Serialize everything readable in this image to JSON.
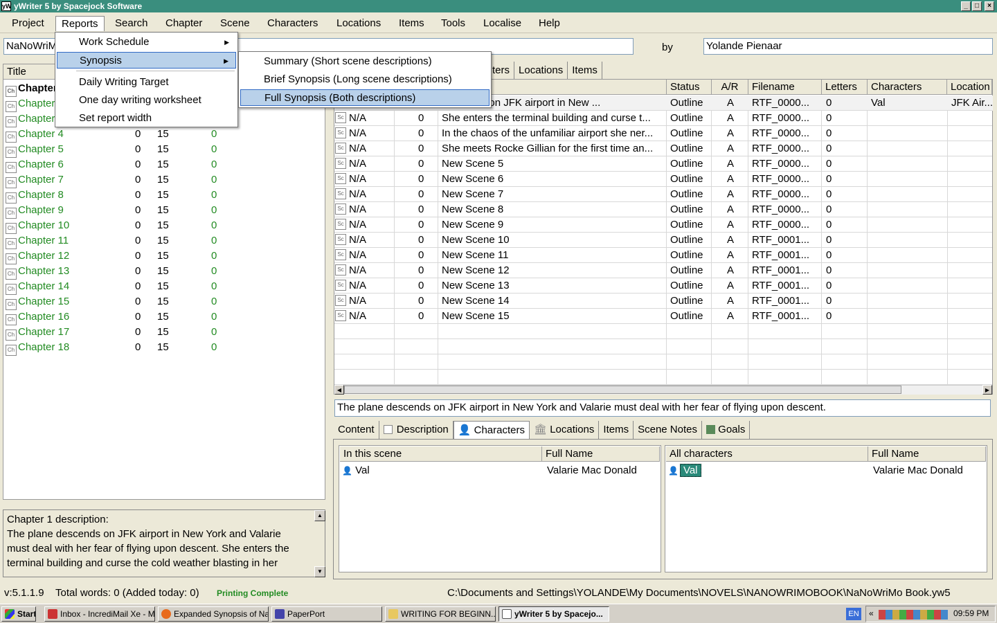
{
  "window": {
    "title": "yWriter 5 by Spacejock Software",
    "app_icon": "yW"
  },
  "menubar": [
    "Project",
    "Reports",
    "Search",
    "Chapter",
    "Scene",
    "Characters",
    "Locations",
    "Items",
    "Tools",
    "Localise",
    "Help"
  ],
  "project": {
    "title_value": "NaNoWriMo",
    "by_label": "by",
    "author_value": "Yolande Pienaar"
  },
  "chapters_panel": {
    "header_title": "Title",
    "first_rows": [
      "Chapter 1",
      "Chapter 2",
      "Chapter 3"
    ],
    "rows": [
      {
        "title": "Chapter 4",
        "a": "0",
        "b": "15",
        "c": "0"
      },
      {
        "title": "Chapter 5",
        "a": "0",
        "b": "15",
        "c": "0"
      },
      {
        "title": "Chapter 6",
        "a": "0",
        "b": "15",
        "c": "0"
      },
      {
        "title": "Chapter 7",
        "a": "0",
        "b": "15",
        "c": "0"
      },
      {
        "title": "Chapter 8",
        "a": "0",
        "b": "15",
        "c": "0"
      },
      {
        "title": "Chapter 9",
        "a": "0",
        "b": "15",
        "c": "0"
      },
      {
        "title": "Chapter 10",
        "a": "0",
        "b": "15",
        "c": "0"
      },
      {
        "title": "Chapter 11",
        "a": "0",
        "b": "15",
        "c": "0"
      },
      {
        "title": "Chapter 12",
        "a": "0",
        "b": "15",
        "c": "0"
      },
      {
        "title": "Chapter 13",
        "a": "0",
        "b": "15",
        "c": "0"
      },
      {
        "title": "Chapter 14",
        "a": "0",
        "b": "15",
        "c": "0"
      },
      {
        "title": "Chapter 15",
        "a": "0",
        "b": "15",
        "c": "0"
      },
      {
        "title": "Chapter 16",
        "a": "0",
        "b": "15",
        "c": "0"
      },
      {
        "title": "Chapter 17",
        "a": "0",
        "b": "15",
        "c": "0"
      },
      {
        "title": "Chapter 18",
        "a": "0",
        "b": "15",
        "c": "0"
      }
    ]
  },
  "chapter_description": {
    "heading": "Chapter 1 description:",
    "lines": [
      "The plane descends on JFK airport in New York and Valarie",
      "must deal with her fear of flying upon descent. She enters the",
      "terminal building and curse the cold weather blasting in her"
    ]
  },
  "top_tabs": [
    "ters",
    "Locations",
    "Items"
  ],
  "scene_columns": [
    "Status",
    "A/R",
    "Filename",
    "Letters",
    "Characters",
    "Location"
  ],
  "scenes": [
    {
      "wc": "",
      "desc": "descends on JFK airport in New ...",
      "status": "Outline",
      "ar": "A",
      "file": "RTF_0000...",
      "letters": "0",
      "chars": "Val",
      "loc": "JFK Air..."
    },
    {
      "wc": "N/A",
      "n": "0",
      "desc": "She enters the terminal building and curse t...",
      "status": "Outline",
      "ar": "A",
      "file": "RTF_0000...",
      "letters": "0"
    },
    {
      "wc": "N/A",
      "n": "0",
      "desc": "In the chaos of the unfamiliar airport she ner...",
      "status": "Outline",
      "ar": "A",
      "file": "RTF_0000...",
      "letters": "0"
    },
    {
      "wc": "N/A",
      "n": "0",
      "desc": "She meets Rocke Gillian for the first time an...",
      "status": "Outline",
      "ar": "A",
      "file": "RTF_0000...",
      "letters": "0"
    },
    {
      "wc": "N/A",
      "n": "0",
      "desc": "New Scene 5",
      "status": "Outline",
      "ar": "A",
      "file": "RTF_0000...",
      "letters": "0"
    },
    {
      "wc": "N/A",
      "n": "0",
      "desc": "New Scene 6",
      "status": "Outline",
      "ar": "A",
      "file": "RTF_0000...",
      "letters": "0"
    },
    {
      "wc": "N/A",
      "n": "0",
      "desc": "New Scene 7",
      "status": "Outline",
      "ar": "A",
      "file": "RTF_0000...",
      "letters": "0"
    },
    {
      "wc": "N/A",
      "n": "0",
      "desc": "New Scene 8",
      "status": "Outline",
      "ar": "A",
      "file": "RTF_0000...",
      "letters": "0"
    },
    {
      "wc": "N/A",
      "n": "0",
      "desc": "New Scene 9",
      "status": "Outline",
      "ar": "A",
      "file": "RTF_0000...",
      "letters": "0"
    },
    {
      "wc": "N/A",
      "n": "0",
      "desc": "New Scene 10",
      "status": "Outline",
      "ar": "A",
      "file": "RTF_0001...",
      "letters": "0"
    },
    {
      "wc": "N/A",
      "n": "0",
      "desc": "New Scene 11",
      "status": "Outline",
      "ar": "A",
      "file": "RTF_0001...",
      "letters": "0"
    },
    {
      "wc": "N/A",
      "n": "0",
      "desc": "New Scene 12",
      "status": "Outline",
      "ar": "A",
      "file": "RTF_0001...",
      "letters": "0"
    },
    {
      "wc": "N/A",
      "n": "0",
      "desc": "New Scene 13",
      "status": "Outline",
      "ar": "A",
      "file": "RTF_0001...",
      "letters": "0"
    },
    {
      "wc": "N/A",
      "n": "0",
      "desc": "New Scene 14",
      "status": "Outline",
      "ar": "A",
      "file": "RTF_0001...",
      "letters": "0"
    },
    {
      "wc": "N/A",
      "n": "0",
      "desc": "New Scene 15",
      "status": "Outline",
      "ar": "A",
      "file": "RTF_0001...",
      "letters": "0"
    }
  ],
  "scene_summary": "The plane descends on JFK airport in New York and Valarie must deal with her fear of flying upon descent.",
  "bottom_tabs": [
    "Content",
    "Description",
    "Characters",
    "Locations",
    "Items",
    "Scene Notes",
    "Goals"
  ],
  "in_scene": {
    "col1": "In this scene",
    "col2": "Full Name",
    "rows": [
      {
        "name": "Val",
        "full": "Valarie Mac Donald"
      }
    ]
  },
  "all_chars": {
    "col1": "All characters",
    "col2": "Full Name",
    "rows": [
      {
        "name": "Val",
        "full": "Valarie Mac Donald"
      }
    ]
  },
  "reports_menu": {
    "items": [
      "Work Schedule",
      "Synopsis",
      "Daily Writing Target",
      "One day writing worksheet",
      "Set report width"
    ],
    "synopsis_submenu": [
      "Summary (Short scene descriptions)",
      "Brief Synopsis (Long scene descriptions)",
      "Full Synopsis (Both descriptions)"
    ]
  },
  "status": {
    "version": "v:5.1.1.9",
    "words": "Total words: 0 (Added today: 0)",
    "printing": "Printing Complete",
    "path": "C:\\Documents and Settings\\YOLANDE\\My Documents\\NOVELS\\NANOWRIMOBOOK\\NaNoWriMo Book.yw5"
  },
  "taskbar": {
    "start": "Start",
    "buttons": [
      "Inbox - IncrediMail Xe - M...",
      "Expanded Synopsis of Na...",
      "PaperPort",
      "WRITING FOR BEGINN...",
      "yWriter 5 by Spacejo..."
    ],
    "lang": "EN",
    "clock": "09:59 PM"
  },
  "colors": {
    "title_bar": "#3a8e7e",
    "chapter_text": "#228b22",
    "menu_highlight": "#b9d1ea",
    "status_green": "#228b22"
  }
}
